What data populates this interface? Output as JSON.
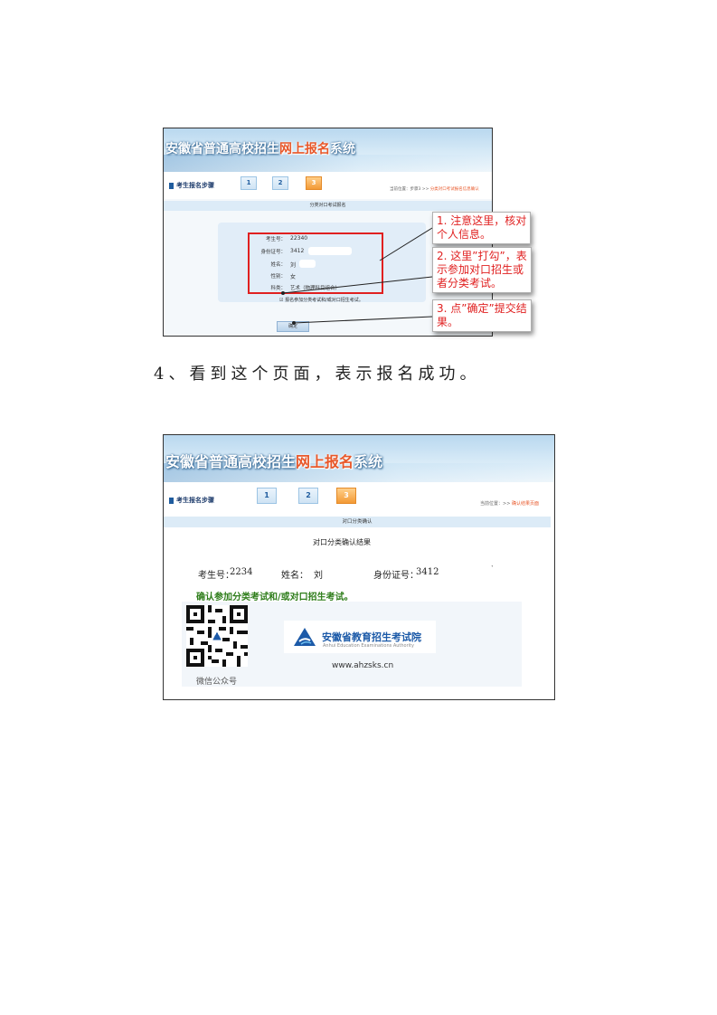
{
  "screenshot1": {
    "banner": {
      "title_pre": "安徽省普通高校招生",
      "title_highlight": "网上报名",
      "title_post": "系统"
    },
    "steps_label": "考生报名步骤",
    "steps": [
      "1",
      "2",
      "3"
    ],
    "location": {
      "prefix": "当前位置：",
      "mid": "步骤3 >> ",
      "highlight": "分类对口考试报名信息确认"
    },
    "section_title": "分类对口考试报名",
    "fields": [
      {
        "label": "考生号：",
        "value": "22340"
      },
      {
        "label": "身份证号：",
        "value": "3412"
      },
      {
        "label": "姓名：",
        "value": "刘"
      },
      {
        "label": "性别：",
        "value": "女"
      },
      {
        "label": "科类：",
        "value": "艺术（物理科目组合）"
      }
    ],
    "checkbox_text": "报名参加分类考试和/或对口招生考试。",
    "confirm_button": "确定",
    "callouts": [
      [
        "1. 注意这里，核对",
        "个人信息。"
      ],
      [
        "2. 这里”打勾”，表",
        "示参加对口招生或",
        "者分类考试。"
      ],
      [
        "3. 点”确定”提交结",
        "果。"
      ]
    ]
  },
  "caption": "4、看到这个页面，表示报名成功。",
  "screenshot2": {
    "banner": {
      "title_pre": "安徽省普通高校招生",
      "title_highlight": "网上报名",
      "title_post": "系统"
    },
    "steps_label": "考生报名步骤",
    "steps": [
      "1",
      "2",
      "3"
    ],
    "location": {
      "prefix": "当前位置：",
      "mid": ">> ",
      "highlight": "确认结果页面"
    },
    "section_title": "对口分类确认",
    "result_title": "对口分类确认结果",
    "info": {
      "exam_no_label": "考生号：",
      "exam_no": "2234",
      "name_label": "姓名：",
      "name": "刘",
      "id_label": "身份证号：",
      "id": "3412"
    },
    "confirm_text": "确认参加分类考试和/或对口招生考试。",
    "org_name": "安徽省教育招生考试院",
    "org_name_en": "Anhui Education Examinations Authority",
    "url": "www.ahzsks.cn",
    "wechat_label": "微信公众号"
  },
  "colors": {
    "accent_orange": "#e8582a",
    "callout_red": "#e02020",
    "nav_blue": "#1f5c9e",
    "confirm_green": "#2e7d1a"
  }
}
